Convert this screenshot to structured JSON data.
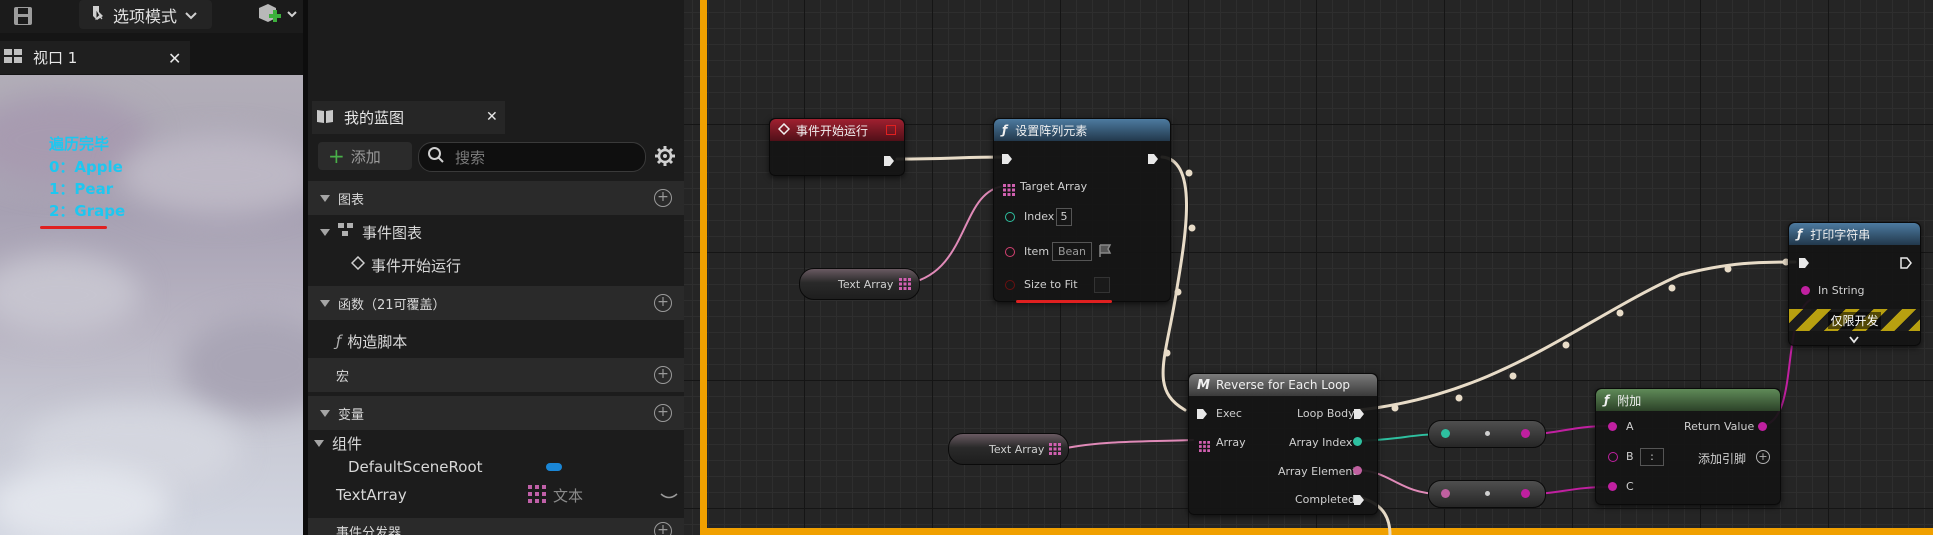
{
  "toolbar": {
    "save_icon": "save-icon",
    "mode_label": "选项模式",
    "add_actor_icon": "add-actor-icon"
  },
  "viewport": {
    "tab_title": "视口 1",
    "log_lines": [
      "遍历完毕",
      "0：Apple",
      "1：Pear",
      "2：Grape"
    ],
    "log_color": "#1ec7f0",
    "underline_color": "#e02020"
  },
  "my_blueprint": {
    "tab_title": "我的蓝图",
    "add_label": "添加",
    "search_placeholder": "搜索",
    "sections": {
      "graphs": "图表",
      "event_graph": "事件图表",
      "event_begin_play": "事件开始运行",
      "functions": "函数（21可覆盖）",
      "construction_script": "构造脚本",
      "macros": "宏",
      "variables": "变量",
      "components": "组件",
      "default_scene_root": "DefaultSceneRoot",
      "text_array_var": "TextArray",
      "text_array_type": "文本",
      "event_dispatchers": "事件分发器"
    }
  },
  "graph": {
    "begin_play": {
      "title": "事件开始运行"
    },
    "set_array_elem": {
      "title": "设置阵列元素",
      "target_array": "Target Array",
      "index_label": "Index",
      "index_value": "5",
      "item_label": "Item",
      "item_value": "Bean",
      "size_to_fit": "Size to Fit"
    },
    "text_array_node_1": "Text Array",
    "text_array_node_2": "Text Array",
    "reverse_loop": {
      "title": "Reverse for Each Loop",
      "exec": "Exec",
      "array": "Array",
      "loop_body": "Loop Body",
      "array_index": "Array Index",
      "array_element": "Array Element",
      "completed": "Completed"
    },
    "append": {
      "title": "附加",
      "a": "A",
      "b": "B",
      "b_value": ":",
      "c": "C",
      "return_value": "Return Value",
      "add_pin": "添加引脚"
    },
    "print_string": {
      "title": "打印字符串",
      "in_string": "In String",
      "dev_only": "仅限开发"
    }
  }
}
